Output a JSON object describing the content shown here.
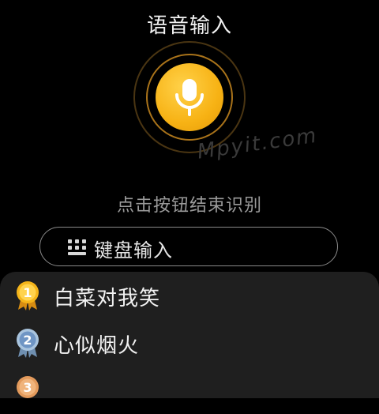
{
  "header": {
    "title": "语音输入"
  },
  "watermark": "Mpyit.com",
  "hint": "点击按钮结束识别",
  "keyboard_button": {
    "label": "键盘输入",
    "icon": "keyboard-icon"
  },
  "ranking": [
    {
      "rank": "1",
      "name": "白菜对我笑",
      "medal_color": "#f5b51a"
    },
    {
      "rank": "2",
      "name": "心似烟火",
      "medal_color": "#a9c4de"
    },
    {
      "rank": "3",
      "name": "",
      "medal_color": "#e39a5c"
    }
  ],
  "colors": {
    "accent": "#f7b214",
    "background": "#000000",
    "sheet": "#1f1f1f"
  }
}
